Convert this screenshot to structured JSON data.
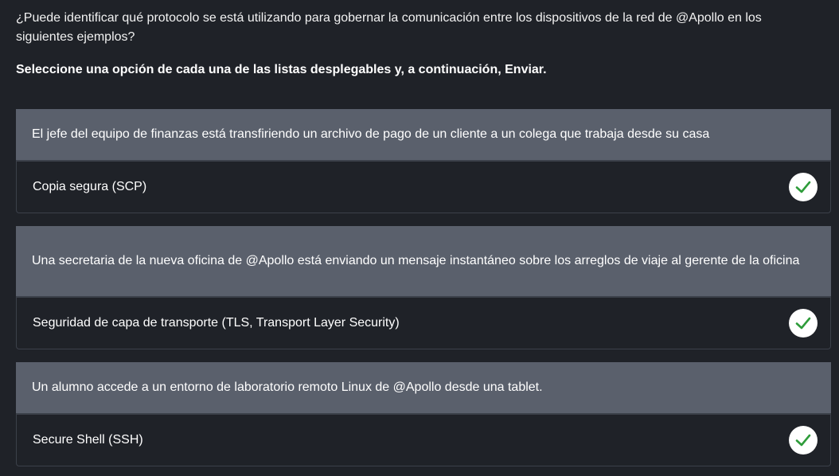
{
  "intro": "¿Puede identificar qué protocolo se está utilizando para gobernar la comunicación entre los dispositivos de la red de @Apollo en los siguientes ejemplos?",
  "instruction": "Seleccione una opción de cada una de las listas desplegables y, a continuación, Enviar.",
  "questions": [
    {
      "text": "El jefe del equipo de finanzas está transfiriendo un archivo de pago de un cliente a un colega que trabaja desde su casa",
      "answer": "Copia segura (SCP)",
      "status_icon": "check-icon"
    },
    {
      "text": "Una secretaria de la nueva oficina de @Apollo está enviando un mensaje instantáneo sobre los arreglos de viaje al gerente de la oficina",
      "answer": "Seguridad de capa de transporte (TLS, Transport Layer Security)",
      "status_icon": "check-icon"
    },
    {
      "text": "Un alumno accede a un entorno de laboratorio remoto Linux de @Apollo desde una tablet.",
      "answer": "Secure Shell (SSH)",
      "status_icon": "check-icon"
    }
  ],
  "colors": {
    "background": "#1f2228",
    "question_bar": "#5a606c",
    "check_mark": "#2e9c3a"
  }
}
